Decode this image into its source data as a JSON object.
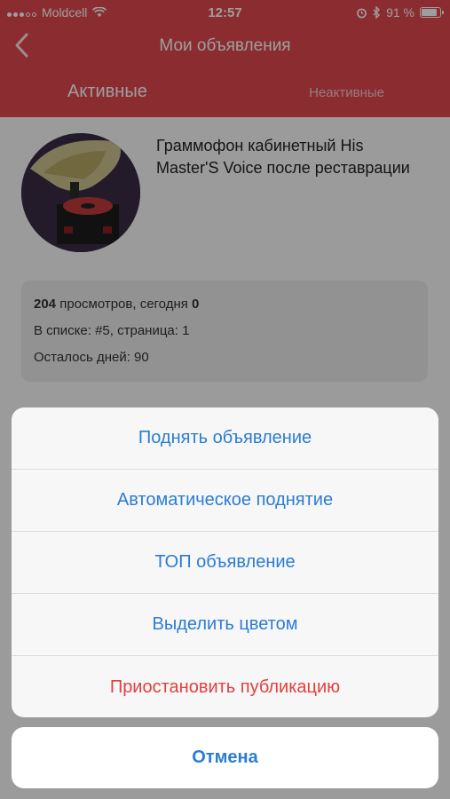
{
  "status_bar": {
    "carrier": "Moldcell",
    "time": "12:57",
    "battery_percent": "91 %",
    "battery_level": 0.91
  },
  "nav": {
    "title": "Мои объявления",
    "back_icon": "chevron-left-icon"
  },
  "tabs": [
    {
      "label": "Активные",
      "active": true
    },
    {
      "label": "Неактивные",
      "active": false
    }
  ],
  "listing": {
    "title": "Граммофон кабинетный His Master'S Voice после реставрации",
    "views_count": "204",
    "views_text": "просмотров, сегодня",
    "today_count": "0",
    "position_text": "В списке:  #5, страница: 1",
    "days_left_text": "Осталось дней: 90"
  },
  "action_sheet": {
    "actions": [
      {
        "label": "Поднять объявление",
        "destructive": false
      },
      {
        "label": "Автоматическое поднятие",
        "destructive": false
      },
      {
        "label": "ТОП объявление",
        "destructive": false
      },
      {
        "label": "Выделить цветом",
        "destructive": false
      },
      {
        "label": "Приостановить публикацию",
        "destructive": true
      }
    ],
    "cancel_label": "Отмена"
  },
  "colors": {
    "header_red": "#e04a4e",
    "action_blue": "#2b7cd3",
    "destructive_red": "#e0403f"
  }
}
